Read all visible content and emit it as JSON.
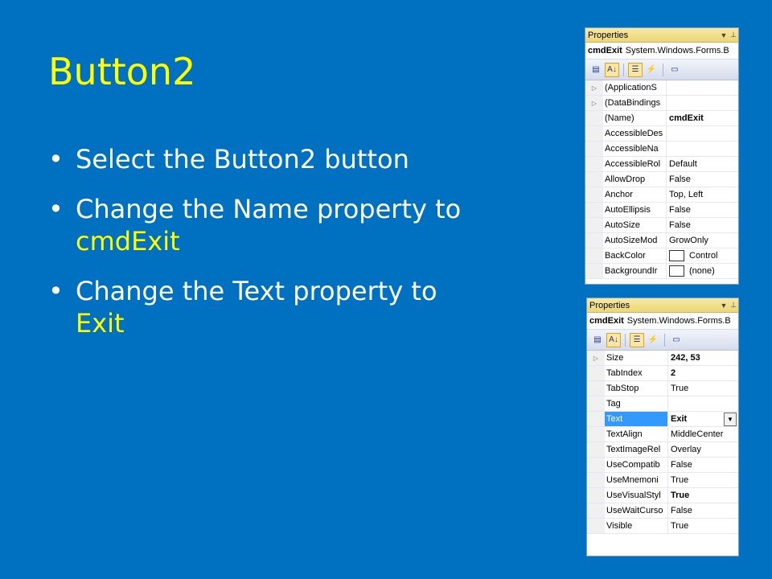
{
  "slide": {
    "title": "Button2",
    "bullets": [
      {
        "text": "Select the Button2 button",
        "highlight": ""
      },
      {
        "text": "Change the Name property to",
        "highlight": "cmdExit"
      },
      {
        "text": "Change the Text property to",
        "highlight": "Exit"
      }
    ]
  },
  "panel1": {
    "title": "Properties",
    "pin_icon": "pin-icon",
    "dropdown_icon": "chevron-down-icon",
    "object_name": "cmdExit",
    "object_type": "System.Windows.Forms.B",
    "rows": [
      {
        "name": "(ApplicationS",
        "value": "",
        "expand": "▷"
      },
      {
        "name": "(DataBindings",
        "value": "",
        "expand": "▷"
      },
      {
        "name": "(Name)",
        "value": "cmdExit",
        "bold": true
      },
      {
        "name": "AccessibleDes",
        "value": ""
      },
      {
        "name": "AccessibleNa",
        "value": ""
      },
      {
        "name": "AccessibleRol",
        "value": "Default"
      },
      {
        "name": "AllowDrop",
        "value": "False"
      },
      {
        "name": "Anchor",
        "value": "Top, Left"
      },
      {
        "name": "AutoEllipsis",
        "value": "False"
      },
      {
        "name": "AutoSize",
        "value": "False"
      },
      {
        "name": "AutoSizeMod",
        "value": "GrowOnly"
      },
      {
        "name": "BackColor",
        "value": "Control",
        "swatch": true
      },
      {
        "name": "BackgroundIr",
        "value": "(none)",
        "swatch": true
      }
    ]
  },
  "panel2": {
    "title": "Properties",
    "object_name": "cmdExit",
    "object_type": "System.Windows.Forms.B",
    "rows": [
      {
        "name": "Size",
        "value": "242, 53",
        "bold": true,
        "expand": "▷"
      },
      {
        "name": "TabIndex",
        "value": "2",
        "bold": true
      },
      {
        "name": "TabStop",
        "value": "True"
      },
      {
        "name": "Tag",
        "value": ""
      },
      {
        "name": "Text",
        "value": "Exit",
        "bold": true,
        "selected": true
      },
      {
        "name": "TextAlign",
        "value": "MiddleCenter"
      },
      {
        "name": "TextImageRel",
        "value": "Overlay"
      },
      {
        "name": "UseCompatib",
        "value": "False"
      },
      {
        "name": "UseMnemoni",
        "value": "True"
      },
      {
        "name": "UseVisualStyl",
        "value": "True",
        "bold": true
      },
      {
        "name": "UseWaitCurso",
        "value": "False"
      },
      {
        "name": "Visible",
        "value": "True"
      }
    ]
  },
  "toolbar": {
    "icons": [
      "categorized-icon",
      "alphabetical-icon",
      "properties-icon",
      "events-icon",
      "property-pages-icon"
    ]
  }
}
